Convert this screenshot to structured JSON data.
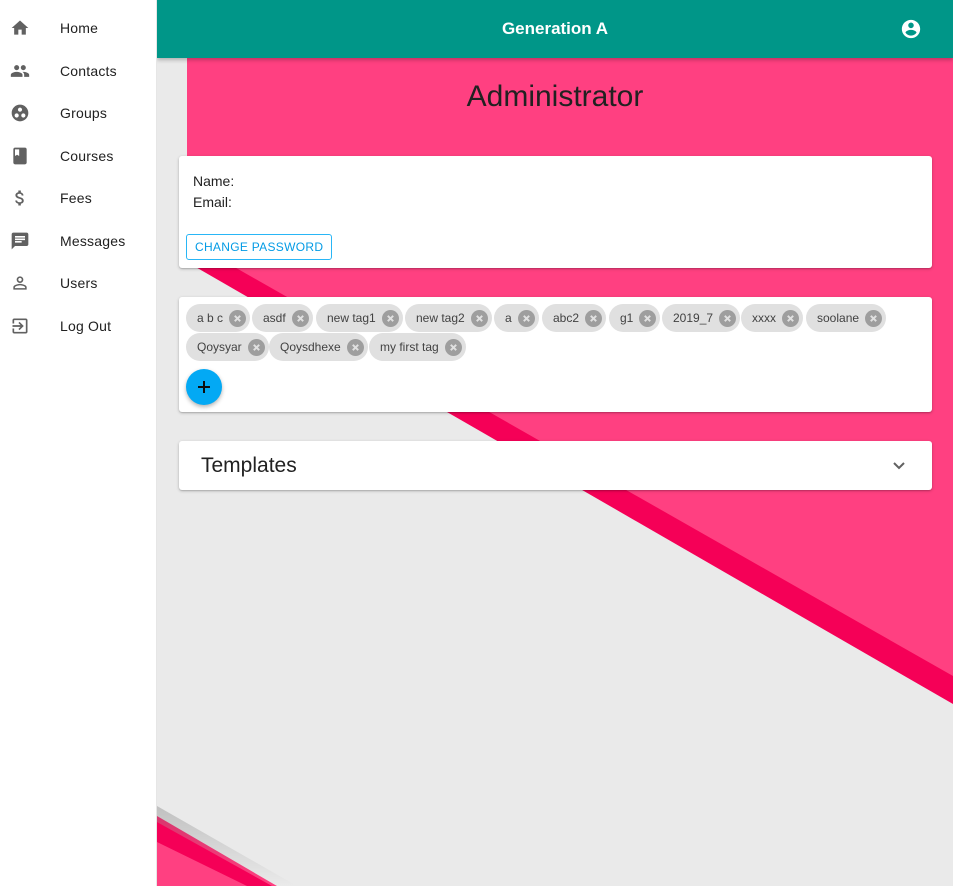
{
  "sidebar": {
    "items": [
      {
        "label": "Home",
        "icon": "home-icon"
      },
      {
        "label": "Contacts",
        "icon": "contacts-icon"
      },
      {
        "label": "Groups",
        "icon": "groups-icon"
      },
      {
        "label": "Courses",
        "icon": "book-icon"
      },
      {
        "label": "Fees",
        "icon": "dollar-icon"
      },
      {
        "label": "Messages",
        "icon": "message-icon"
      },
      {
        "label": "Users",
        "icon": "user-icon"
      },
      {
        "label": "Log Out",
        "icon": "logout-icon"
      }
    ]
  },
  "appbar": {
    "title": "Generation A",
    "account_icon": "account-circle-icon",
    "color": "#009688"
  },
  "page": {
    "title": "Administrator"
  },
  "profile": {
    "name_label": "Name:",
    "email_label": "Email:",
    "change_password_label": "CHANGE PASSWORD"
  },
  "tags": {
    "items": [
      "a b c",
      "asdf",
      "new tag1",
      "new tag2",
      "a",
      "abc2",
      "g1",
      "2019_7",
      "xxxx",
      "soolane",
      "Qoysyar",
      "Qoysdhexe",
      "my first tag"
    ],
    "add_icon": "plus-icon"
  },
  "templates": {
    "label": "Templates",
    "expand_icon": "chevron-down-icon"
  },
  "colors": {
    "accent_pink": "#ff4081",
    "stripe_pink": "#f50057",
    "fab_blue": "#03a9f4",
    "teal": "#009688"
  }
}
